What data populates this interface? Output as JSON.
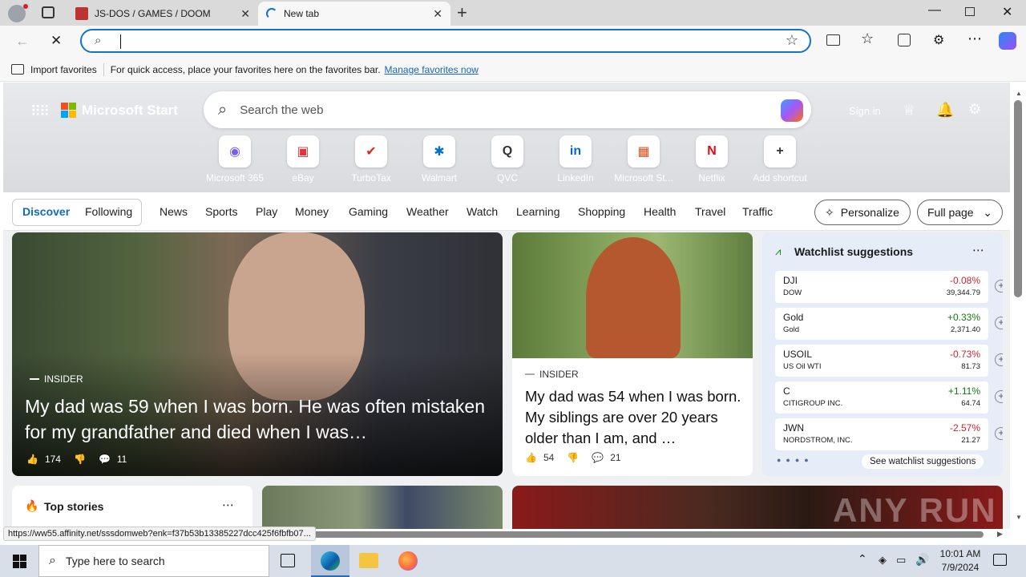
{
  "browser": {
    "tabs": [
      {
        "title": "JS-DOS / GAMES / DOOM"
      },
      {
        "title": "New tab"
      }
    ],
    "address_value": "",
    "favorites_bar": {
      "import_label": "Import favorites",
      "message": "For quick access, place your favorites here on the favorites bar.",
      "manage_link": "Manage favorites now"
    }
  },
  "start": {
    "brand": "Microsoft Start",
    "sign_in": "Sign in",
    "search_placeholder": "Search the web",
    "shortcuts": [
      {
        "label": "Microsoft 365",
        "color": "#7b5cf0",
        "glyph": "◉"
      },
      {
        "label": "eBay",
        "color": "#e53238",
        "glyph": "▣"
      },
      {
        "label": "TurboTax",
        "color": "#d52b1e",
        "glyph": "✔"
      },
      {
        "label": "Walmart",
        "color": "#0071ce",
        "glyph": "✱"
      },
      {
        "label": "QVC",
        "color": "#333333",
        "glyph": "Q"
      },
      {
        "label": "LinkedIn",
        "color": "#0a66c2",
        "glyph": "in"
      },
      {
        "label": "Microsoft St...",
        "color": "#f25022",
        "glyph": "▦"
      },
      {
        "label": "Netflix",
        "color": "#e50914",
        "glyph": "N"
      },
      {
        "label": "Add shortcut",
        "color": "#333333",
        "glyph": "+"
      }
    ],
    "nav": {
      "discover": "Discover",
      "following": "Following",
      "items": [
        "News",
        "Sports",
        "Play",
        "Money",
        "Gaming",
        "Weather",
        "Watch",
        "Learning",
        "Shopping",
        "Health",
        "Travel",
        "Traffic"
      ],
      "personalize": "Personalize",
      "full_page": "Full page"
    },
    "hero": {
      "source": "INSIDER",
      "headline": "My dad was 59 when I was born. He was often mistaken for my grandfather and died when I was…",
      "likes": "174",
      "comments": "11"
    },
    "card2": {
      "source": "INSIDER",
      "headline": "My dad was 54 when I was born. My siblings are over 20 years older than I am, and …",
      "likes": "54",
      "comments": "21"
    },
    "watchlist": {
      "title": "Watchlist suggestions",
      "footer": "See watchlist suggestions",
      "colors": {
        "down": "#c4262e",
        "up": "#0f7b0f"
      },
      "rows": [
        {
          "name": "DJI",
          "full": "DOW",
          "pct": "-0.08%",
          "value": "39,344.79",
          "dir": "down"
        },
        {
          "name": "Gold",
          "full": "Gold",
          "pct": "+0.33%",
          "value": "2,371.40",
          "dir": "up"
        },
        {
          "name": "USOIL",
          "full": "US Oil WTI",
          "pct": "-0.73%",
          "value": "81.73",
          "dir": "down"
        },
        {
          "name": "C",
          "full": "CITIGROUP INC.",
          "pct": "+1.11%",
          "value": "64.74",
          "dir": "up"
        },
        {
          "name": "JWN",
          "full": "NORDSTROM, INC.",
          "pct": "-2.57%",
          "value": "21.27",
          "dir": "down"
        }
      ]
    },
    "top_stories": "Top stories"
  },
  "status_url": "https://ww55.affinity.net/sssdomweb?enk=f37b53b13385227dcc425f6fbfb07...",
  "watermark": "ANY RUN",
  "taskbar": {
    "search_placeholder": "Type here to search",
    "time": "10:01 AM",
    "date": "7/9/2024"
  }
}
